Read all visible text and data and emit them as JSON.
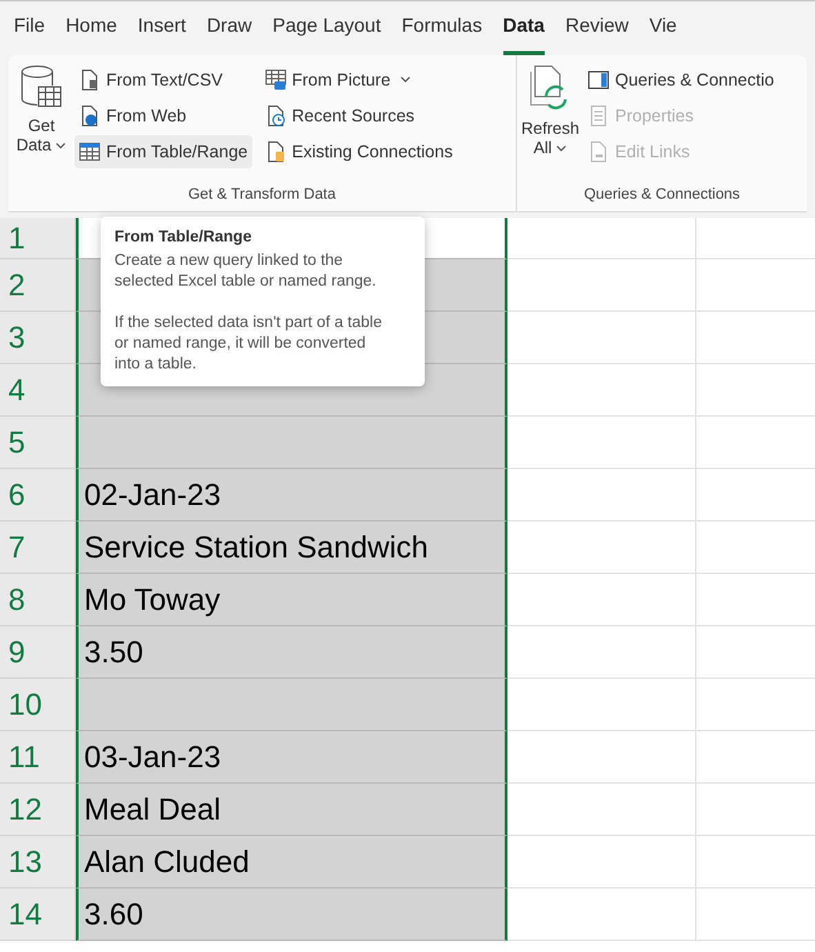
{
  "menu_tabs": [
    {
      "label": "File",
      "selected": false
    },
    {
      "label": "Home",
      "selected": false
    },
    {
      "label": "Insert",
      "selected": false
    },
    {
      "label": "Draw",
      "selected": false
    },
    {
      "label": "Page Layout",
      "selected": false
    },
    {
      "label": "Formulas",
      "selected": false
    },
    {
      "label": "Data",
      "selected": true
    },
    {
      "label": "Review",
      "selected": false
    },
    {
      "label": "Vie",
      "selected": false
    }
  ],
  "groups": [
    {
      "label": "Get & Transform Data",
      "large_button": {
        "kind": "database",
        "label": "Get",
        "label2": "Data"
      },
      "items": [
        {
          "label": "From Text/CSV",
          "dropdown": false,
          "hovered": false,
          "disabled": false
        },
        {
          "label": "From Web",
          "dropdown": false,
          "hovered": false,
          "disabled": false
        },
        {
          "label": "From Table/Range",
          "dropdown": false,
          "hovered": true,
          "disabled": false
        },
        {
          "label": "From Picture",
          "dropdown": true,
          "hovered": false,
          "disabled": false
        },
        {
          "label": "Recent Sources",
          "dropdown": false,
          "hovered": false,
          "disabled": false
        },
        {
          "label": "Existing Connections",
          "dropdown": false,
          "hovered": false,
          "disabled": false
        }
      ]
    },
    {
      "label": "Queries & Connections",
      "large_button": {
        "kind": "refresh",
        "label": "Refresh",
        "label2": "All"
      },
      "items": [
        {
          "label": "Queries & Connectio",
          "dropdown": false,
          "hovered": false,
          "disabled": false
        },
        {
          "label": "Properties",
          "dropdown": false,
          "hovered": false,
          "disabled": true
        },
        {
          "label": "Edit Links",
          "dropdown": false,
          "hovered": false,
          "disabled": true
        }
      ]
    }
  ],
  "tooltip": {
    "title": "From Table/Range",
    "paragraphs": [
      "Create a new query linked to the selected Excel table or named range.",
      "If the selected data isn't part of a table or named range, it will be converted into a table."
    ]
  },
  "rows": [
    {
      "number": "1",
      "active": true
    },
    {
      "number": "2",
      "active": false
    },
    {
      "number": "3",
      "active": false
    },
    {
      "number": "4",
      "active": false
    },
    {
      "number": "5",
      "active": false
    },
    {
      "number": "6",
      "cell": "02-Jan-23",
      "active": false
    },
    {
      "number": "7",
      "cell": "Service Station Sandwich",
      "active": false
    },
    {
      "number": "8",
      "cell": "Mo Toway",
      "active": false
    },
    {
      "number": "9",
      "cell": "3.50",
      "active": false
    },
    {
      "number": "10",
      "active": false
    },
    {
      "number": "11",
      "cell": "03-Jan-23",
      "active": false
    },
    {
      "number": "12",
      "cell": "Meal Deal",
      "active": false
    },
    {
      "number": "13",
      "cell": "Alan Cluded",
      "active": false
    },
    {
      "number": "14",
      "cell": "3.60",
      "active": false
    }
  ]
}
